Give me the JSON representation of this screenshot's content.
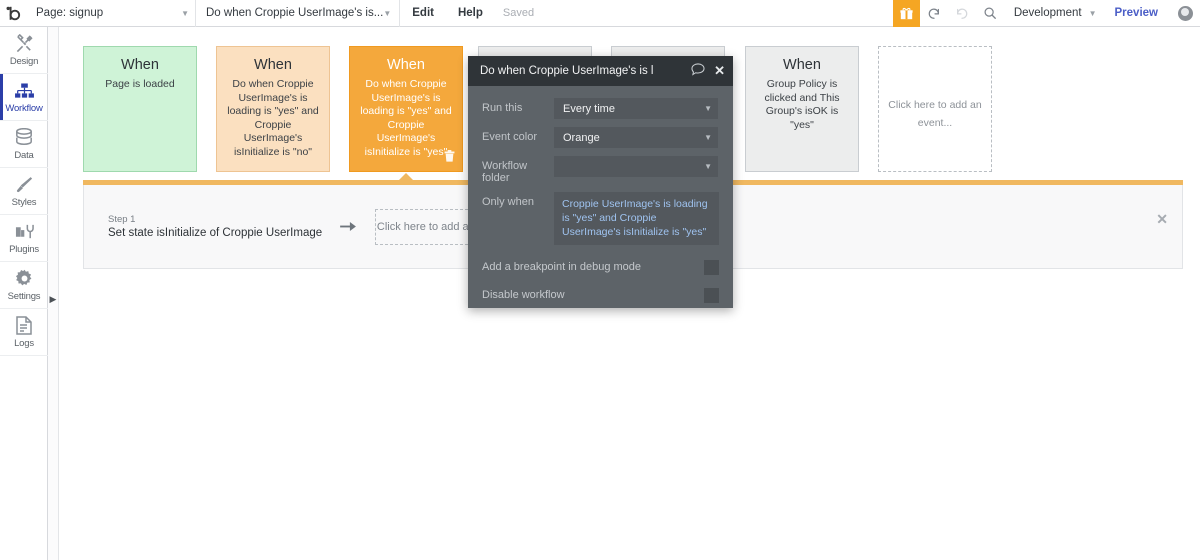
{
  "topbar": {
    "logo": "b-logo-icon",
    "page_label": "Page: signup",
    "workflow_label": "Do when Croppie UserImage's is...",
    "edit_label": "Edit",
    "help_label": "Help",
    "saved_label": "Saved",
    "gift_icon": "gift-icon",
    "undo_icon": "undo-icon",
    "redo_icon": "redo-icon",
    "search_icon": "search-icon",
    "environment": "Development",
    "preview_label": "Preview",
    "avatar": "user-avatar",
    "accent_orange": "#f5a623",
    "accent_blue": "#4b5ec7"
  },
  "sidebar": {
    "items": [
      {
        "label": "Design",
        "icon": "design-tools-icon",
        "active": false
      },
      {
        "label": "Workflow",
        "icon": "workflow-tree-icon",
        "active": true
      },
      {
        "label": "Data",
        "icon": "database-icon",
        "active": false
      },
      {
        "label": "Styles",
        "icon": "paintbrush-icon",
        "active": false
      },
      {
        "label": "Plugins",
        "icon": "plugins-icon",
        "active": false
      },
      {
        "label": "Settings",
        "icon": "gear-icon",
        "active": false
      },
      {
        "label": "Logs",
        "icon": "document-icon",
        "active": false
      }
    ],
    "active_color": "#2b3ea8"
  },
  "workflow": {
    "cards": [
      {
        "when": "When",
        "desc": "Page is loaded",
        "color": "green",
        "hex": "#cff3d7",
        "selected": false
      },
      {
        "when": "When",
        "desc": "Do when Croppie UserImage's is loading is \"yes\" and Croppie UserImage's isInitialize is \"no\"",
        "color": "peach",
        "hex": "#fbe0c0",
        "selected": false
      },
      {
        "when": "When",
        "desc": "Do when Croppie UserImage's is loading is \"yes\" and Croppie UserImage's isInitialize is \"yes\"",
        "color": "orange",
        "hex": "#f4a83c",
        "selected": true,
        "trash_icon": "trash-icon"
      },
      {
        "when": "When",
        "desc": "Group Policy is clicked and This Group's isOK is \"yes\"",
        "color": "grey",
        "hex": "#eceded",
        "selected": false
      }
    ],
    "add_event_label": "Click here to add an event...",
    "separator_color": "#f0b860"
  },
  "step_panel": {
    "step_number": "Step 1",
    "step_title": "Set state isInitialize of Croppie UserImage",
    "arrow_icon": "arrow-right-icon",
    "add_action_label": "Click here to add an action...",
    "close_icon": "close-icon"
  },
  "dialog": {
    "title": "Do when Croppie UserImage's is l",
    "comment_icon": "comment-bubble-icon",
    "close_icon": "close-icon",
    "fields": [
      {
        "label": "Run this",
        "value": "Every time",
        "type": "dropdown"
      },
      {
        "label": "Event color",
        "value": "Orange",
        "type": "dropdown"
      },
      {
        "label": "Workflow folder",
        "value": "",
        "type": "dropdown"
      }
    ],
    "only_when": {
      "label": "Only when",
      "expression": "Croppie UserImage's is loading is \"yes\" and Croppie UserImage's isInitialize is \"yes\"",
      "expression_color": "#9fc3f0"
    },
    "checkboxes": [
      {
        "label": "Add a breakpoint in debug mode",
        "checked": false
      },
      {
        "label": "Disable workflow",
        "checked": false
      }
    ],
    "background": "#5d6368",
    "header_background": "#2f3438"
  }
}
